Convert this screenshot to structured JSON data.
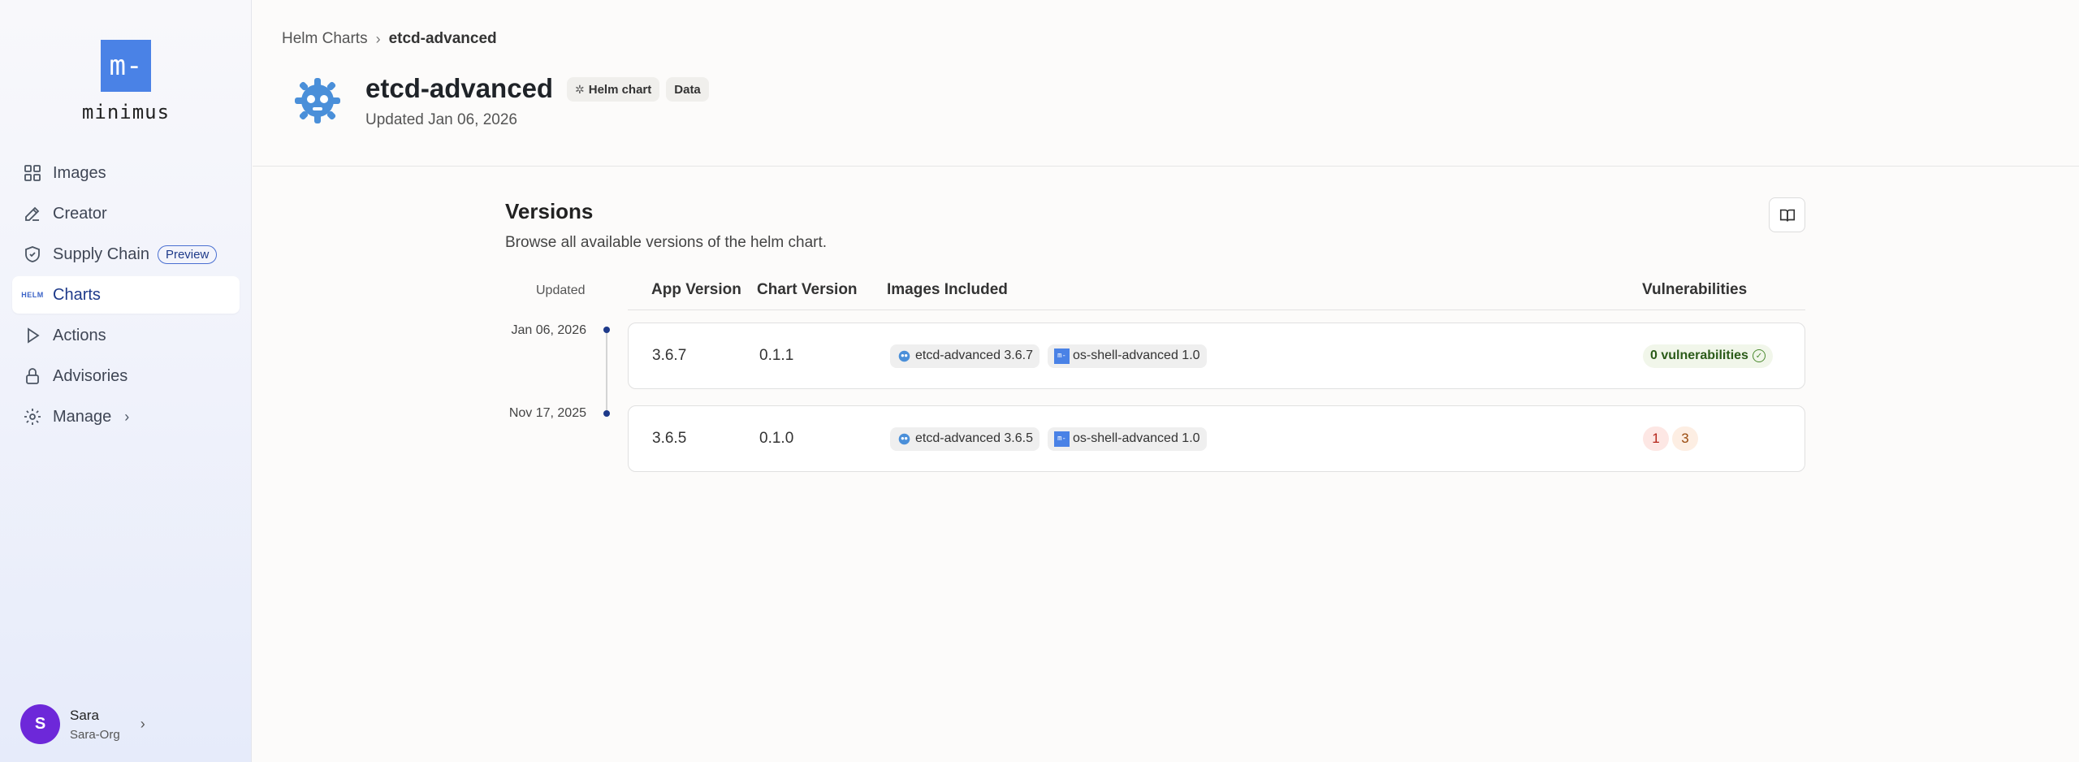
{
  "sidebar": {
    "logo_mark": "m-",
    "logo_text": "minimus",
    "items": [
      {
        "label": "Images",
        "icon": "grid-icon"
      },
      {
        "label": "Creator",
        "icon": "pencil-icon"
      },
      {
        "label": "Supply Chain",
        "icon": "shield-icon",
        "badge": "Preview"
      },
      {
        "label": "Charts",
        "icon": "helm-icon",
        "icon_text": "HELM",
        "active": true
      },
      {
        "label": "Actions",
        "icon": "play-icon"
      },
      {
        "label": "Advisories",
        "icon": "lock-icon"
      },
      {
        "label": "Manage",
        "icon": "gear-icon",
        "chevron": "›"
      }
    ],
    "user": {
      "initial": "S",
      "name": "Sara",
      "org": "Sara-Org"
    }
  },
  "breadcrumb": {
    "parent": "Helm Charts",
    "separator": "›",
    "current": "etcd-advanced"
  },
  "chart": {
    "title": "etcd-advanced",
    "badges": [
      "Helm chart",
      "Data"
    ],
    "updated": "Updated Jan 06, 2026"
  },
  "versions": {
    "title": "Versions",
    "subtitle": "Browse all available versions of the helm chart.",
    "columns": {
      "updated": "Updated",
      "app_version": "App Version",
      "chart_version": "Chart Version",
      "images": "Images Included",
      "vulnerabilities": "Vulnerabilities"
    },
    "rows": [
      {
        "date": "Jan 06, 2026",
        "app_version": "3.6.7",
        "chart_version": "0.1.1",
        "images": [
          {
            "name": "etcd-advanced 3.6.7",
            "icon": "etcd-icon"
          },
          {
            "name": "os-shell-advanced 1.0",
            "icon": "minimus-icon"
          }
        ],
        "vulnerabilities_text": "0 vulnerabilities"
      },
      {
        "date": "Nov 17, 2025",
        "app_version": "3.6.5",
        "chart_version": "0.1.0",
        "images": [
          {
            "name": "etcd-advanced 3.6.5",
            "icon": "etcd-icon"
          },
          {
            "name": "os-shell-advanced 1.0",
            "icon": "minimus-icon"
          }
        ],
        "vulnerabilities": {
          "critical": "1",
          "high": "3"
        }
      }
    ]
  },
  "colors": {
    "accent": "#4a82e6",
    "active_text": "#1e3a8a",
    "avatar": "#6d28d9"
  }
}
